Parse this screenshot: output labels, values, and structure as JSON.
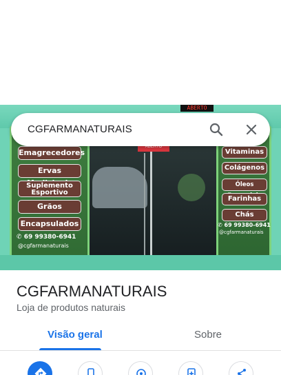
{
  "search": {
    "query": "CGFARMANATURAIS"
  },
  "photo": {
    "led_text": "ABERTO",
    "door_sign": "ABERTO",
    "left_banner": [
      "Emagrecedores",
      "Ervas Medicinais",
      "Suplemento Esportivo",
      "Grãos",
      "Encapsulados"
    ],
    "right_banner": [
      "Vitaminas",
      "Colágenos",
      "Óleos Essenciais",
      "Farinhas",
      "Chás"
    ],
    "phone": "69 99380-6941",
    "instagram": "@cgfarmanaturais"
  },
  "place": {
    "name": "CGFARMANATURAIS",
    "category": "Loja de produtos naturais"
  },
  "tabs": {
    "overview": "Visão geral",
    "about": "Sobre"
  },
  "colors": {
    "accent": "#1a73e8",
    "text_primary": "#202124",
    "text_secondary": "#5f6368"
  },
  "actions": [
    "directions-icon",
    "phone-icon",
    "location-icon",
    "add-place-icon",
    "share-icon"
  ]
}
